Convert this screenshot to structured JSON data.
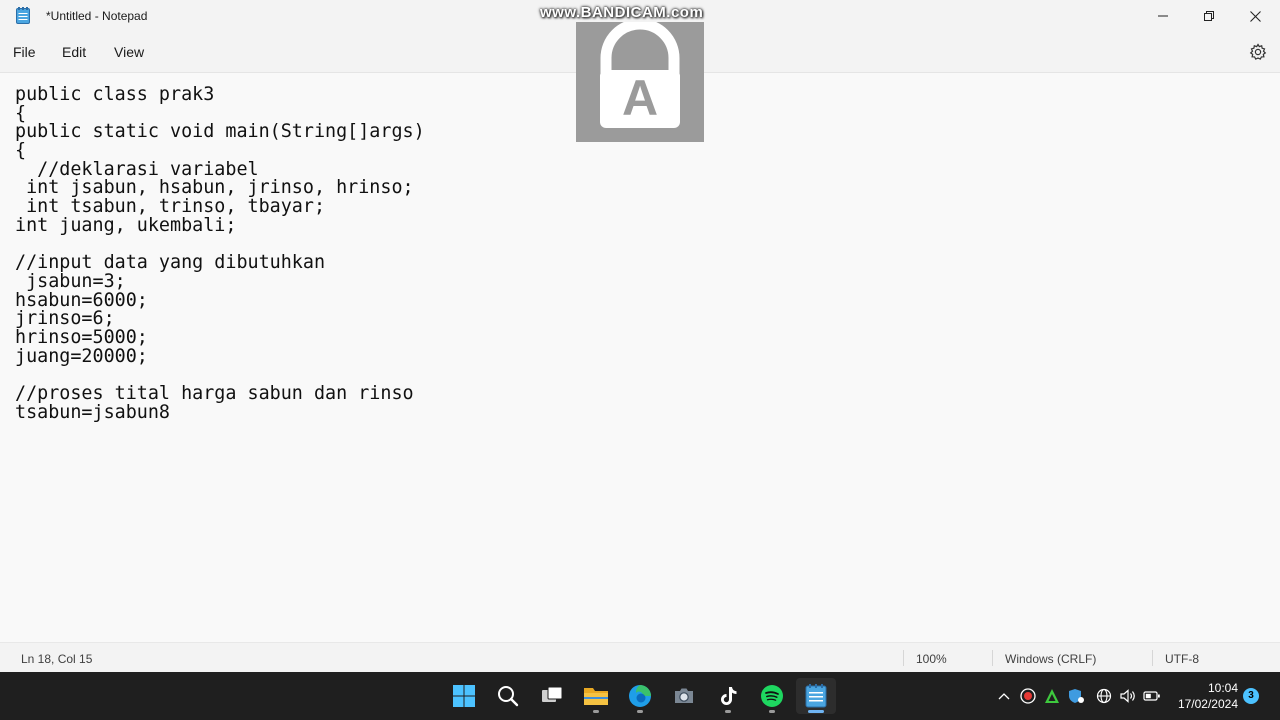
{
  "window": {
    "title": "*Untitled - Notepad"
  },
  "watermark": {
    "text": "www.BANDICAM.com",
    "letter": "A"
  },
  "menu": {
    "file": "File",
    "edit": "Edit",
    "view": "View"
  },
  "editor": {
    "lines": [
      "public class prak3",
      "{",
      "public static void main(String[]args)",
      "{",
      "  //deklarasi variabel",
      " int jsabun, hsabun, jrinso, hrinso;",
      " int tsabun, trinso, tbayar;",
      "int juang, ukembali;",
      "",
      "//input data yang dibutuhkan",
      " jsabun=3;",
      "hsabun=6000;",
      "jrinso=6;",
      "hrinso=5000;",
      "juang=20000;",
      "",
      "//proses tital harga sabun dan rinso",
      "tsabun=jsabun8"
    ]
  },
  "status": {
    "position": "Ln 18, Col 15",
    "zoom": "100%",
    "line_ending": "Windows (CRLF)",
    "encoding": "UTF-8"
  },
  "taskbar": {
    "apps": [
      {
        "name": "start-icon"
      },
      {
        "name": "search-icon"
      },
      {
        "name": "task-view-icon"
      },
      {
        "name": "file-explorer-icon"
      },
      {
        "name": "edge-icon"
      },
      {
        "name": "camera-icon"
      },
      {
        "name": "tiktok-icon"
      },
      {
        "name": "spotify-icon"
      },
      {
        "name": "notepad-icon"
      }
    ],
    "clock_time": "10:04",
    "clock_date": "17/02/2024",
    "notification_count": "3"
  },
  "colors": {
    "accent": "#0067c0",
    "taskbar_bg": "#1f1f1f",
    "spotify": "#1ed760",
    "edge": "#1f9ee8",
    "explorer": "#f5c242"
  }
}
